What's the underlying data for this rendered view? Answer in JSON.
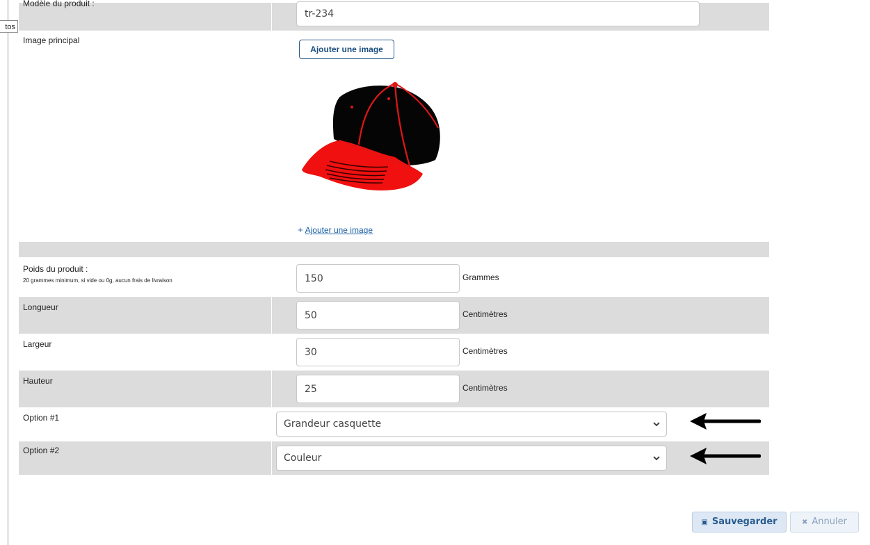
{
  "side_tab": "tos",
  "model": {
    "label": "Modèle du produit :",
    "value": "tr-234"
  },
  "main_image": {
    "label": "Image principal",
    "add_button": "Ajouter une image",
    "add_link_plus": "+",
    "add_link": "Ajouter une image",
    "image_icon": "baseball-cap-icon"
  },
  "fields": [
    {
      "label": "Poids du produit :",
      "note": "20 grammes minimum, si vide ou 0g, aucun frais de livraison",
      "value": "150",
      "unit": "Grammes"
    },
    {
      "label": "Longueur",
      "value": "50",
      "unit": "Centimètres"
    },
    {
      "label": "Largeur",
      "value": "30",
      "unit": "Centimètres"
    },
    {
      "label": "Hauteur",
      "value": "25",
      "unit": "Centimètres"
    }
  ],
  "options": [
    {
      "label": "Option #1",
      "selected": "Grandeur casquette"
    },
    {
      "label": "Option #2",
      "selected": "Couleur"
    }
  ],
  "actions": {
    "save": "Sauvegarder",
    "save_icon": "floppy-disk-icon",
    "cancel": "Annuler",
    "cancel_icon": "x-icon"
  },
  "colors": {
    "row_grey": "#dcdcdc",
    "link_blue": "#1a5fa6",
    "save_bg": "#dde8f4"
  }
}
